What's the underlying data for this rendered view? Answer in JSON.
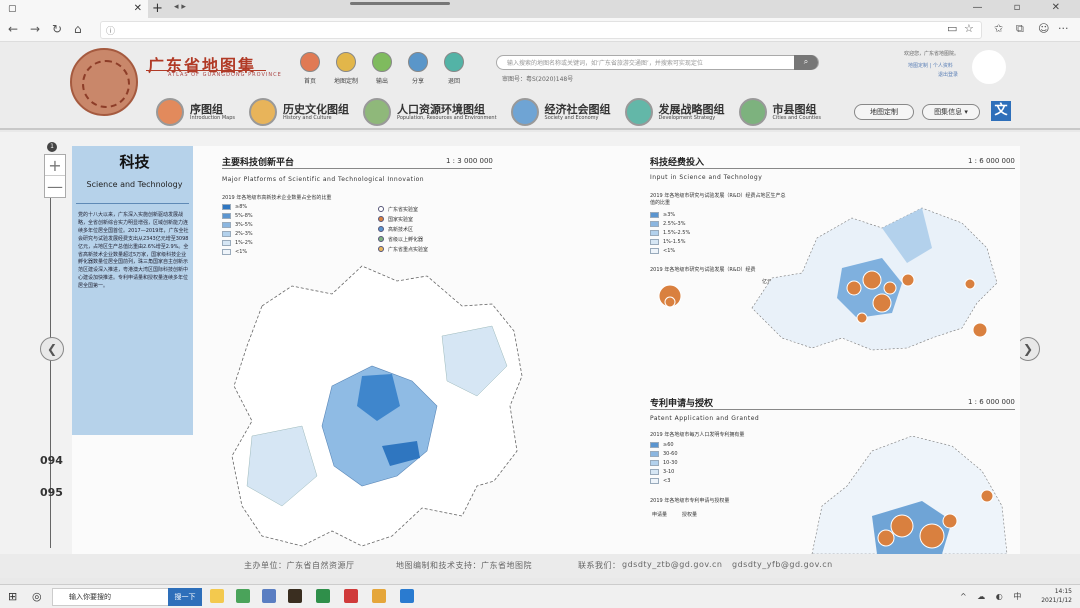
{
  "browser": {
    "tab_title": "",
    "url": ""
  },
  "site": {
    "title": "广东省地图集",
    "subtitle": "ATLAS OF GUANGDONG PROVINCE",
    "nav": [
      {
        "label": "首页",
        "icon": "home-icon",
        "color": "#e07a54"
      },
      {
        "label": "地图定制",
        "icon": "compass-icon",
        "color": "#e2b64a"
      },
      {
        "label": "输出",
        "icon": "output-icon",
        "color": "#7fbb5e"
      },
      {
        "label": "分享",
        "icon": "share-icon",
        "color": "#5a96c9"
      },
      {
        "label": "退回",
        "icon": "back-icon",
        "color": "#53b3a6"
      }
    ],
    "search_placeholder": "输入搜索的地图名称或关键词，如‘广东省旅游交通图’，并搜索可实现定位",
    "map_number": "审图号：粤S(2020)148号",
    "welcome": "欢迎您，广东省地图院。",
    "user_links": [
      "地图定制 | 个人资料",
      "退出登录"
    ],
    "categories": [
      {
        "label": "序图组",
        "sub": "Introduction Maps",
        "color": "#e28a5c"
      },
      {
        "label": "历史文化图组",
        "sub": "History and Culture",
        "color": "#e8b45a"
      },
      {
        "label": "人口资源环境图组",
        "sub": "Population, Resources and Environment",
        "color": "#8fb87a"
      },
      {
        "label": "经济社会图组",
        "sub": "Society and Economy",
        "color": "#6fa4d4"
      },
      {
        "label": "发展战略图组",
        "sub": "Development Strategy",
        "color": "#63b7a8"
      },
      {
        "label": "市县图组",
        "sub": "Cities and Counties",
        "color": "#7db27e"
      }
    ],
    "custom_map_btn": "地图定制",
    "info_btn": "图集信息 ▾",
    "lang_btn": "文"
  },
  "page": {
    "zoom_in": "+",
    "zoom_out": "—",
    "page_marker": "1",
    "page_left": "094",
    "page_right": "095",
    "topic_cn": "科技",
    "topic_en": "Science and Technology",
    "topic_body": "党的十八大以来，广东深入实施创新驱动发展战略，全省创新综合实力明显增强，区域创新能力连续多年位居全国首位。2017—2019年，广东全社会研究与试验发展经费支出从2343亿元增至3098亿元，占地区生产总值比重由2.6%增至2.9%。全省高新技术企业数量超过5万家，国家级科技企业孵化器数量位居全国前列，珠三角国家自主创新示范区建设深入推进，粤港澳大湾区国际科技创新中心建设加快推进。专利申请量和授权量连续多年位居全国第一。"
  },
  "panels": {
    "platforms": {
      "title": "主要科技创新平台",
      "title_en": "Major Platforms of Scientific and Technological Innovation",
      "scale": "1 : 3 000 000",
      "legend_title": "2019 年各地级市高新技术企业数量占全省的比重",
      "legend_items": [
        "≥8%",
        "5%-8%",
        "3%-5%",
        "2%-3%",
        "1%-2%",
        "<1%"
      ],
      "marker_items": [
        "广东省实验室",
        "国家实验室",
        "高新技术区",
        "省级以上孵化器",
        "广东省重点实验室"
      ]
    },
    "funding": {
      "title": "科技经费投入",
      "title_en": "Input in Science and Technology",
      "scale": "1 : 6 000 000",
      "legend_title": "2019 年各地级市研究与试验发展（R&D）经费占地区生产总值的比重",
      "legend_items": [
        "≥3%",
        "2.5%-3%",
        "1.5%-2.5%",
        "1%-1.5%",
        "<1%"
      ],
      "bubble_title": "2019 年各地级市研究与试验发展（R&D）经费",
      "bubble_unit": "亿元"
    },
    "patent": {
      "title": "专利申请与授权",
      "title_en": "Patent Application and Granted",
      "scale": "1 : 6 000 000",
      "legend_title": "2019 年各地级市每万人口发明专利拥有量",
      "legend_items": [
        "≥60",
        "30-60",
        "10-30",
        "3-10",
        "<3"
      ],
      "pie_title": "2019 年各地级市专利申请与授权量",
      "pie_labels": [
        "申请量",
        "授权量"
      ]
    }
  },
  "footer": {
    "host": "主办单位：广东省自然资源厅",
    "tech": "地图编制和技术支持：广东省地图院",
    "contact_label": "联系我们：",
    "email1": "gdsdty_ztb@gd.gov.cn",
    "email2": "gdsdty_yfb@gd.gov.cn"
  },
  "taskbar": {
    "search_placeholder": "输入你要搜的",
    "search_btn": "搜一下",
    "time": "14:15",
    "date": "2021/1/12",
    "ime": "中"
  }
}
